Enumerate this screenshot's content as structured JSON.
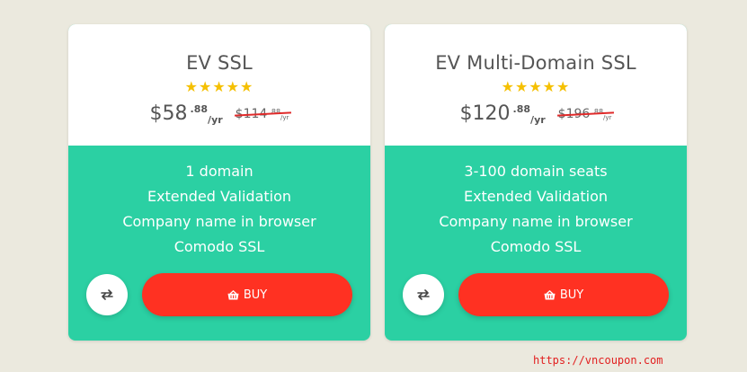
{
  "cards": [
    {
      "title": "EV SSL",
      "stars": "★★★★★",
      "price": {
        "main": "$58",
        "cents": ".88",
        "unit": "/yr"
      },
      "old_price": {
        "main": "$114",
        "cents": ".88",
        "unit": "/yr"
      },
      "features": [
        "1 domain",
        "Extended Validation",
        "Company name in browser",
        "Comodo SSL"
      ],
      "buy_label": "BUY"
    },
    {
      "title": "EV Multi-Domain SSL",
      "stars": "★★★★★",
      "price": {
        "main": "$120",
        "cents": ".88",
        "unit": "/yr"
      },
      "old_price": {
        "main": "$196",
        "cents": ".88",
        "unit": "/yr"
      },
      "features": [
        "3-100 domain seats",
        "Extended Validation",
        "Company name in browser",
        "Comodo SSL"
      ],
      "buy_label": "BUY"
    }
  ],
  "watermark": "https://vncoupon.com",
  "icons": {
    "star": "star-icon",
    "compare": "swap-arrows-icon",
    "buy": "basket-icon"
  },
  "colors": {
    "background": "#ebe9de",
    "card_top": "#ffffff",
    "card_bottom": "#2bd0a3",
    "star": "#f5c000",
    "buy_button": "#ff3122",
    "strike": "#e02a2a",
    "watermark": "#e21f1f"
  }
}
